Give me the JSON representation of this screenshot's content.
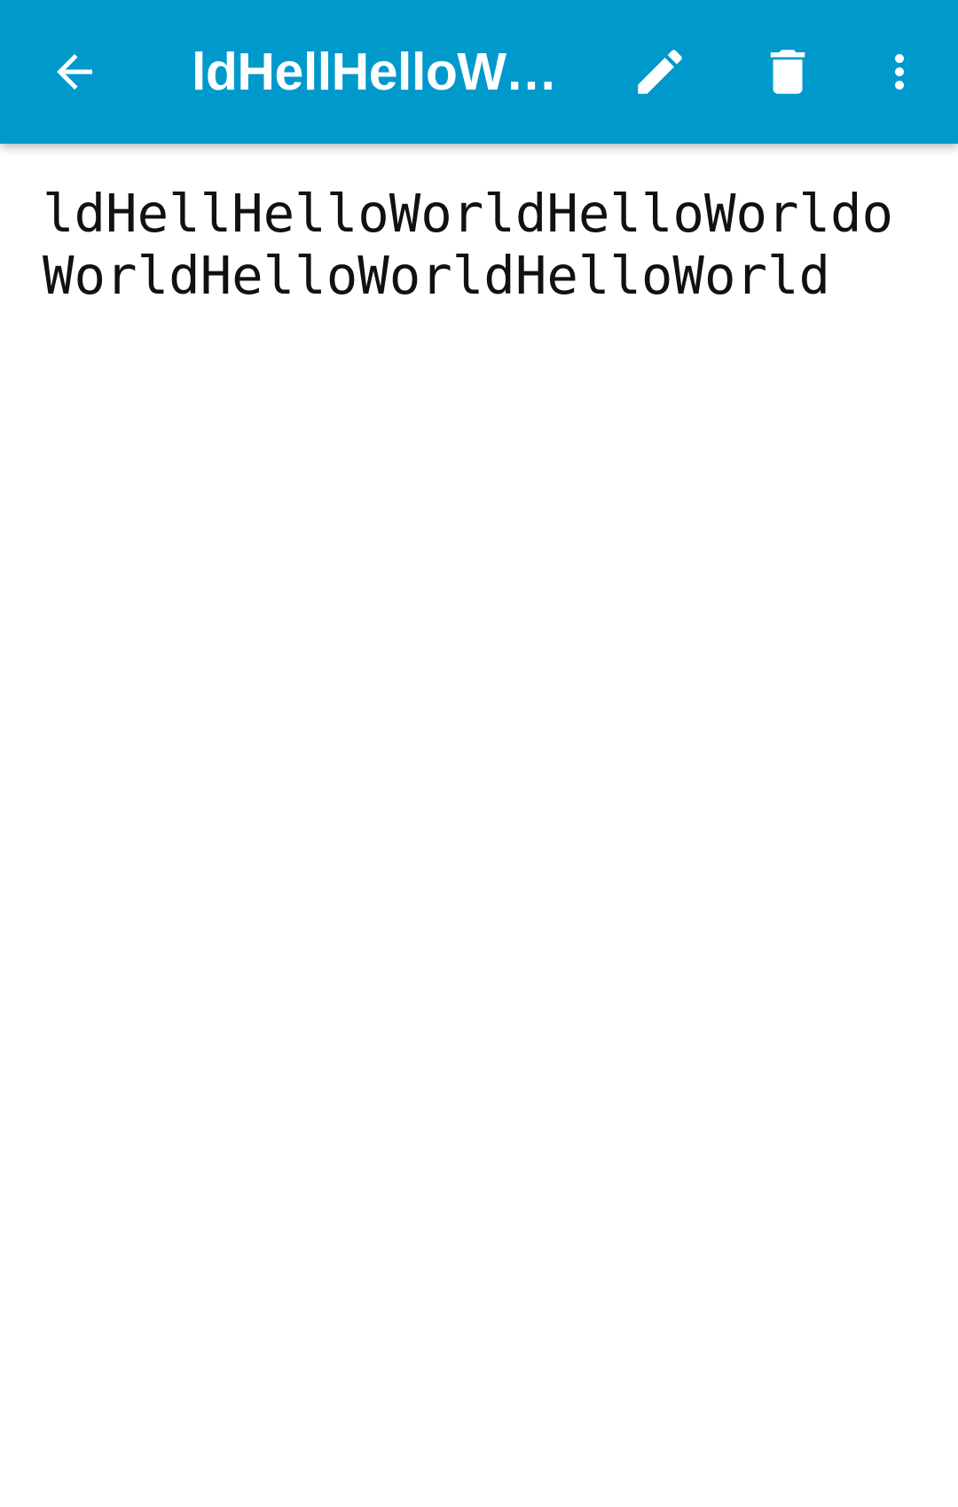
{
  "toolbar": {
    "title": "ldHellHelloWorldHelloWorldoWorldHelloWorldHelloWorld",
    "background_color": "#0099cc",
    "icons": {
      "back": "arrow-back-icon",
      "edit": "pencil-icon",
      "delete": "trash-icon",
      "more": "more-vert-icon"
    }
  },
  "note": {
    "lines": [
      "ldHellHelloWorldHelloWorldo",
      "WorldHelloWorldHelloWorld"
    ]
  }
}
